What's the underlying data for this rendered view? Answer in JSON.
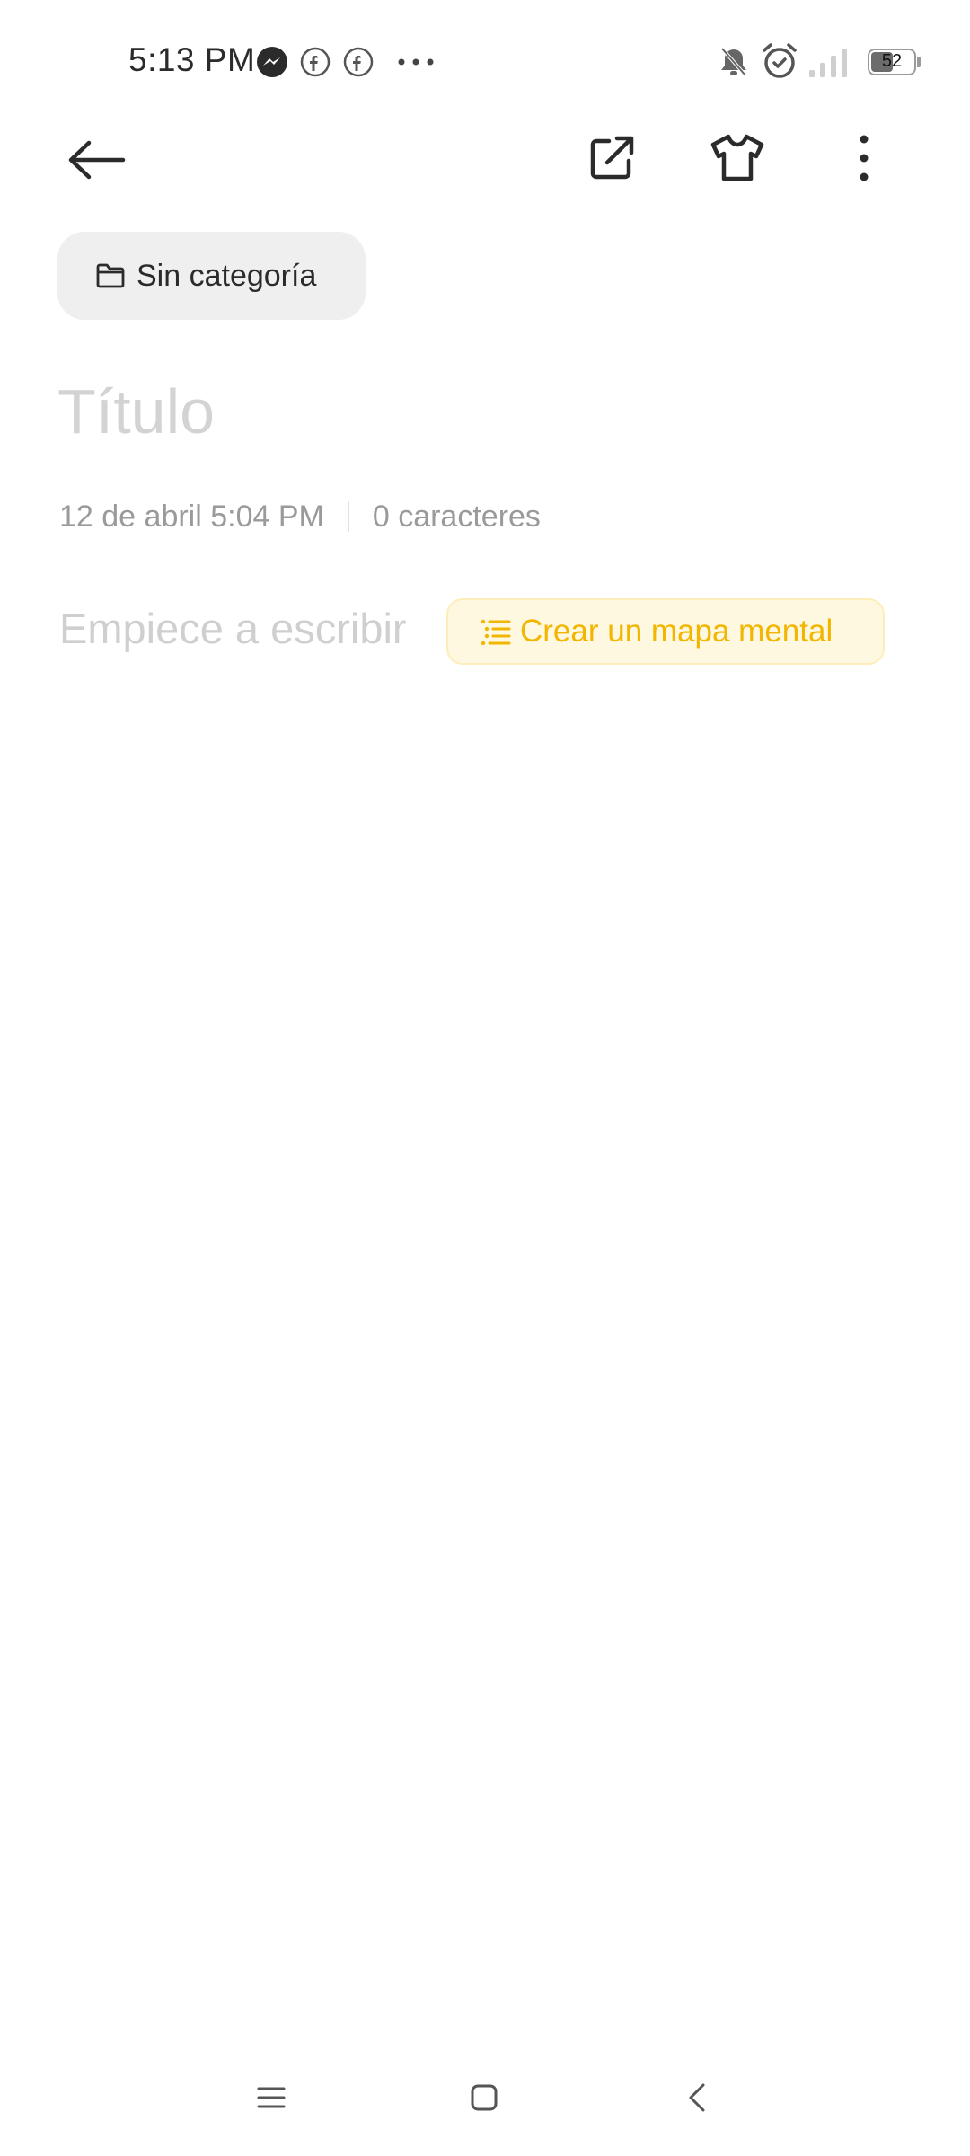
{
  "status_bar": {
    "time": "5:13 PM",
    "notification_icons": [
      "messenger-icon",
      "facebook-icon",
      "facebook-icon",
      "more-notifications-icon"
    ],
    "system_icons": [
      "notifications-muted-icon",
      "alarm-icon",
      "signal-icon"
    ],
    "battery_level": "52"
  },
  "toolbar": {
    "back_icon": "arrow-left-icon",
    "share_icon": "share-external-icon",
    "theme_icon": "tshirt-icon",
    "more_icon": "more-vertical-icon"
  },
  "note": {
    "category_label": "Sin categoría",
    "title_placeholder": "Título",
    "date": "12 de abril 5:04 PM",
    "char_count": "0 caracteres",
    "body_placeholder": "Empiece a escribir",
    "mindmap_button_label": "Crear un mapa mental"
  },
  "colors": {
    "accent": "#f2b600",
    "accent_bg": "#fff8e1",
    "chip_bg": "#efefef",
    "placeholder": "#cfcfcf"
  },
  "nav_bar": {
    "icons": [
      "menu-icon",
      "home-icon",
      "back-icon"
    ]
  }
}
